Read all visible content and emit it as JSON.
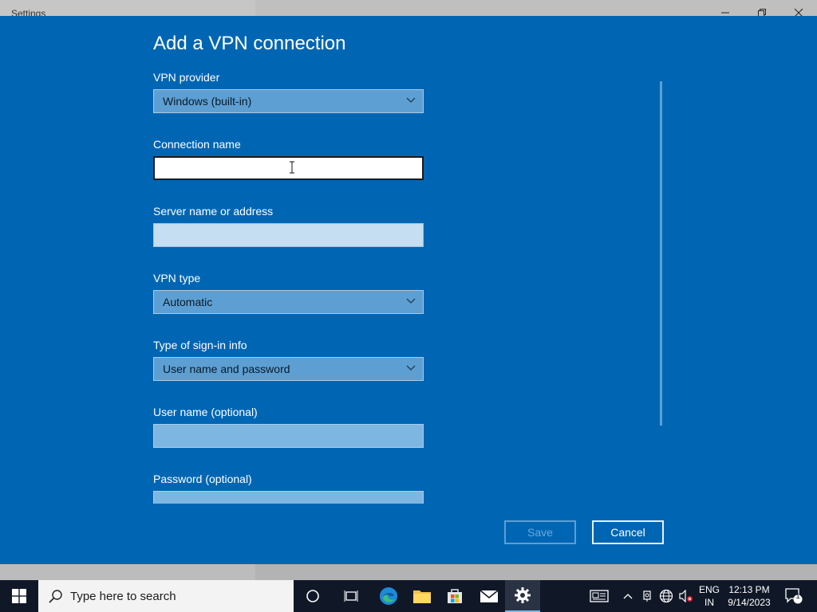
{
  "window": {
    "title": "Settings",
    "minimize_icon": "minimize-icon",
    "maximize_icon": "restore-icon",
    "close_icon": "close-icon"
  },
  "dialog": {
    "title": "Add a VPN connection",
    "accent_color": "#0066b4",
    "fields": {
      "vpn_provider": {
        "label": "VPN provider",
        "value": "Windows (built-in)"
      },
      "connection_name": {
        "label": "Connection name",
        "value": ""
      },
      "server": {
        "label": "Server name or address",
        "value": ""
      },
      "vpn_type": {
        "label": "VPN type",
        "value": "Automatic"
      },
      "sign_in_type": {
        "label": "Type of sign-in info",
        "value": "User name and password"
      },
      "username": {
        "label": "User name (optional)",
        "value": ""
      },
      "password": {
        "label": "Password (optional)",
        "value": ""
      }
    },
    "buttons": {
      "save": "Save",
      "cancel": "Cancel"
    }
  },
  "taskbar": {
    "search_placeholder": "Type here to search",
    "apps": [
      "cortana-icon",
      "task-view-icon",
      "edge-icon",
      "file-explorer-icon",
      "store-icon",
      "mail-icon",
      "settings-icon"
    ],
    "active_app": "settings-icon",
    "tray": {
      "language_line1": "ENG",
      "language_line2": "IN",
      "time": "12:13 PM",
      "date": "9/14/2023",
      "notification_count": "1"
    }
  }
}
